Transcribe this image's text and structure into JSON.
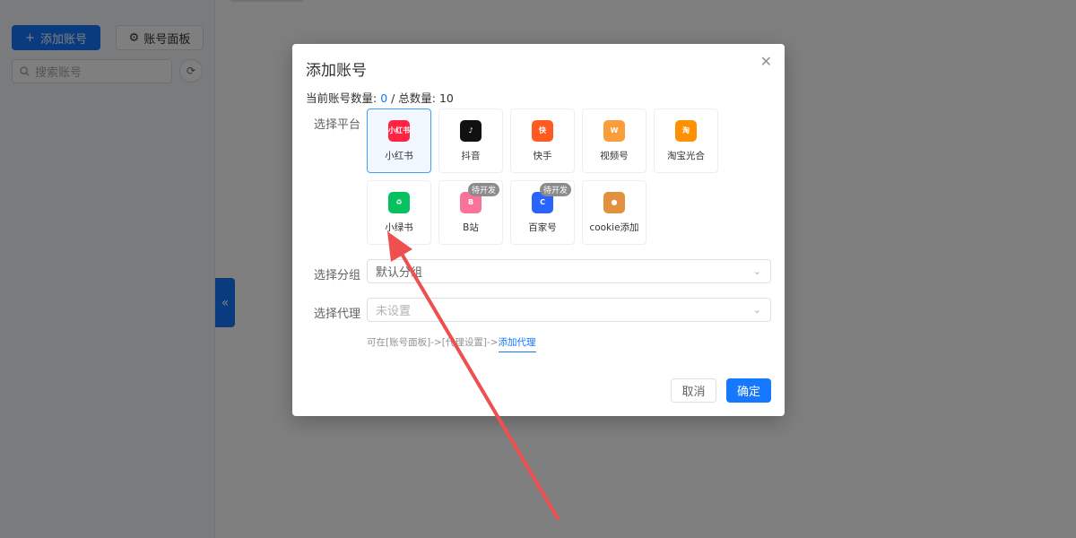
{
  "sidebar": {
    "add_account_label": "添加账号",
    "panel_label": "账号面板",
    "search_placeholder": "搜索账号"
  },
  "modal": {
    "title": "添加账号",
    "count_prefix": "当前账号数量: ",
    "current_count": "0",
    "total_text": " / 总数量: 10",
    "platform_label": "选择平台",
    "group_label": "选择分组",
    "group_value": "默认分组",
    "proxy_label": "选择代理",
    "proxy_placeholder": "未设置",
    "hint_text": "可在[账号面板]->[代理设置]->",
    "hint_link": "添加代理",
    "cancel_label": "取消",
    "confirm_label": "确定"
  },
  "platforms": [
    {
      "name": "小红书",
      "icon_text": "小红书",
      "color": "#ff2442",
      "selected": true
    },
    {
      "name": "抖音",
      "icon_text": "♪",
      "color": "#111111",
      "selected": false
    },
    {
      "name": "快手",
      "icon_text": "快",
      "color": "#ff5a1f",
      "selected": false
    },
    {
      "name": "视频号",
      "icon_text": "W",
      "color": "#fa9d3b",
      "selected": false
    },
    {
      "name": "淘宝光合",
      "icon_text": "淘",
      "color": "#ff9000",
      "selected": false
    },
    {
      "name": "小绿书",
      "icon_text": "♻",
      "color": "#07c160",
      "selected": false
    },
    {
      "name": "B站",
      "icon_text": "B",
      "color": "#fb7299",
      "selected": false,
      "badge": "待开发"
    },
    {
      "name": "百家号",
      "icon_text": "C",
      "color": "#2b63ff",
      "selected": false,
      "badge": "待开发"
    },
    {
      "name": "cookie添加",
      "icon_text": "●",
      "color": "#e2913f",
      "selected": false
    }
  ]
}
